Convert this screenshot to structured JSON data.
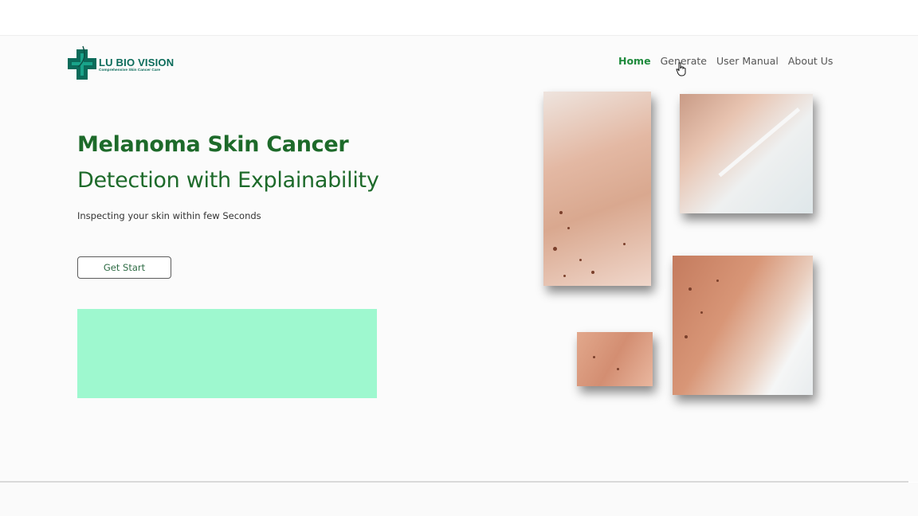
{
  "brand": {
    "name": "LU BIO VISION",
    "tagline": "Comprehensive Skin Cancer Care",
    "colors": {
      "primary": "#0b6b5a",
      "heading": "#1d6a2a",
      "accent_box": "#9ef8cf"
    }
  },
  "nav": {
    "items": [
      {
        "label": "Home",
        "active": true
      },
      {
        "label": "Generate",
        "active": false
      },
      {
        "label": "User Manual",
        "active": false
      },
      {
        "label": "About Us",
        "active": false
      }
    ]
  },
  "hero": {
    "title_line1": "Melanoma Skin Cancer",
    "title_line2": "Detection with Explainability",
    "subtitle": "Inspecting your skin within few Seconds",
    "cta_label": "Get Start"
  },
  "icons": {
    "logo": "medical-cross-icon",
    "cursor": "hand-pointer-icon"
  }
}
